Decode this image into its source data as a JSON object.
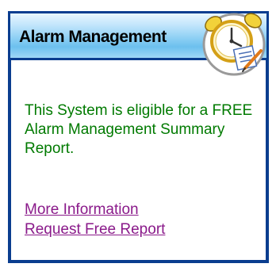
{
  "panel": {
    "title": "Alarm Management",
    "icon": "alarm-clock-report-icon",
    "message": "This System is eligible for a FREE Alarm Management Summary Report.",
    "links": {
      "more_info": "More Information",
      "request_report": "Request Free Report"
    }
  },
  "colors": {
    "border": "#0a3d8f",
    "header_gradient_top": "#e8f6ff",
    "header_gradient_mid": "#6cc0ee",
    "message_text": "#007a00",
    "link_text": "#8a1a8a"
  }
}
